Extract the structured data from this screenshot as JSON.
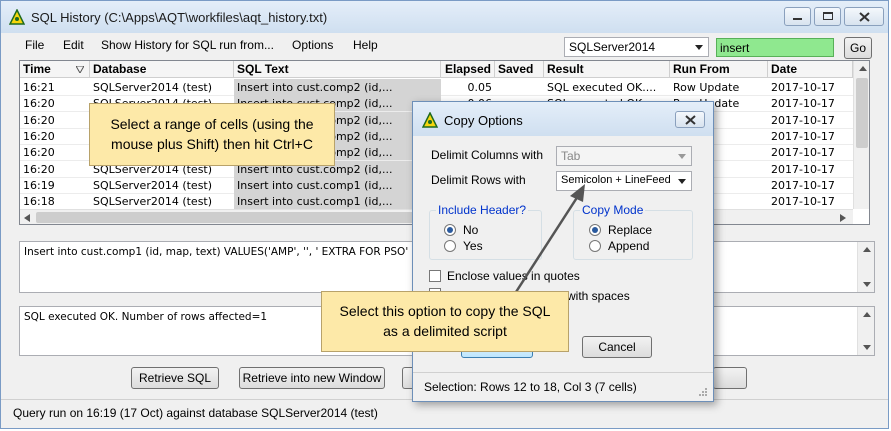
{
  "window": {
    "title": "SQL History (C:\\Apps\\AQT\\workfiles\\aqt_history.txt)"
  },
  "menu": [
    "File",
    "Edit",
    "Show History for SQL run from...",
    "Options",
    "Help"
  ],
  "toolbar": {
    "server": "SQLServer2014",
    "search_value": "insert",
    "go_label": "Go"
  },
  "grid": {
    "columns": [
      "Time",
      "Database",
      "SQL Text",
      "Elapsed",
      "Saved",
      "Result",
      "Run From",
      "Date"
    ],
    "rows": [
      [
        "16:21",
        "SQLServer2014 (test)",
        "Insert into cust.comp2 (id,...",
        "0.05",
        "",
        "SQL executed OK....",
        "Row Update",
        "2017-10-17"
      ],
      [
        "16:20",
        "SQLServer2014 (test)",
        "Insert into cust.comp2 (id,...",
        "0.06",
        "",
        "SQL executed OK....",
        "Row Update",
        "2017-10-17"
      ],
      [
        "16:20",
        "SQLServer2014 (test)",
        "Insert into cust.comp2 (id,...",
        "",
        "",
        "",
        "",
        "2017-10-17"
      ],
      [
        "16:20",
        "SQLServer2014 (test)",
        "Insert into cust.comp2 (id,...",
        "",
        "",
        "",
        "",
        "2017-10-17"
      ],
      [
        "16:20",
        "SQLServer2014 (test)",
        "Insert into cust.comp2 (id,...",
        "",
        "",
        "",
        "",
        "2017-10-17"
      ],
      [
        "16:20",
        "SQLServer2014 (test)",
        "Insert into cust.comp2 (id,...",
        "",
        "",
        "",
        "",
        "2017-10-17"
      ],
      [
        "16:19",
        "SQLServer2014 (test)",
        "Insert into cust.comp1 (id,...",
        "",
        "",
        "",
        "",
        "2017-10-17"
      ],
      [
        "16:18",
        "SQLServer2014 (test)",
        "Insert into cust.comp1 (id,...",
        "",
        "",
        "",
        "",
        "2017-10-17"
      ]
    ]
  },
  "sql_text": "Insert into cust.comp1 (id, map, text) VALUES('AMP', '', '          EXTRA FOR PSO'",
  "result_text": "SQL executed OK. Number of rows affected=1",
  "buttons": {
    "retrieve_sql": "Retrieve SQL",
    "retrieve_new": "Retrieve into new Window"
  },
  "status": "Query run on 16:19 (17 Oct) against database SQLServer2014 (test)",
  "dialog": {
    "title": "Copy Options",
    "delimit_columns_label": "Delimit Columns with",
    "delimit_columns_value": "Tab",
    "delimit_rows_label": "Delimit Rows with",
    "delimit_rows_value": "Semicolon + LineFeed",
    "include_header_title": "Include Header?",
    "header_no": "No",
    "header_yes": "Yes",
    "copy_mode_title": "Copy Mode",
    "mode_replace": "Replace",
    "mode_append": "Append",
    "enclose_label": "Enclose values in quotes",
    "spaces_fragment": "with spaces",
    "cancel_label": "Cancel",
    "selection": "Selection: Rows 12 to 18, Col 3 (7 cells)"
  },
  "callouts": {
    "top": "Select a range of cells (using the mouse plus Shift) then hit Ctrl+C",
    "bottom": "Select this option to copy the SQL as a delimited script"
  },
  "colors": {
    "search_bg": "#8fe88f",
    "callout_bg": "#fde9a8",
    "group_title": "#0033cc"
  }
}
